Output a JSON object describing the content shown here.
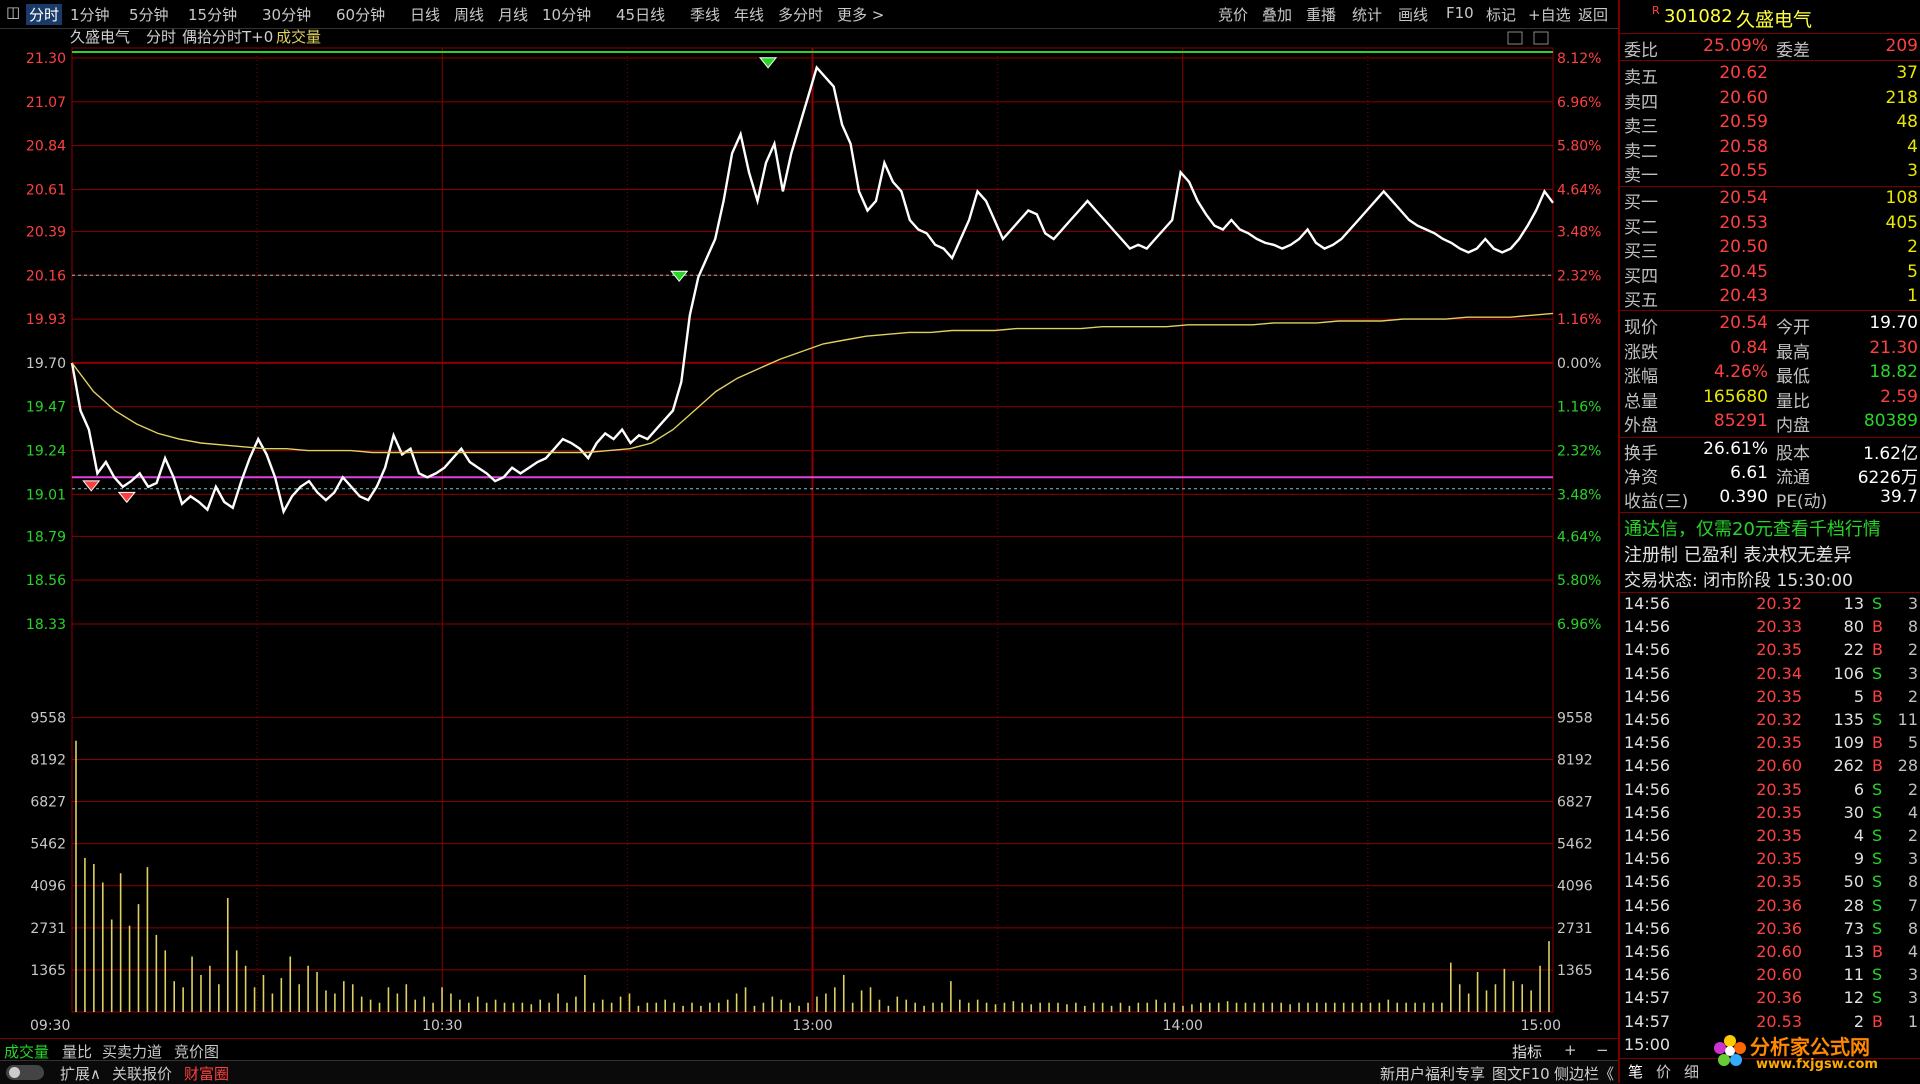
{
  "toolbar": {
    "periods": [
      "分时",
      "1分钟",
      "5分钟",
      "15分钟",
      "30分钟",
      "60分钟",
      "日线",
      "周线",
      "月线",
      "10分钟",
      "45日线",
      "季线",
      "年线",
      "多分时",
      "更多 >"
    ],
    "tools": [
      "竞价",
      "叠加",
      "重播",
      "统计",
      "画线",
      "F10",
      "标记",
      "+自选",
      "返回"
    ]
  },
  "chart_header": {
    "stock_name": "久盛电气",
    "mode": "分时",
    "indicator": "偶拾分时T+0",
    "volume_label": "成交量"
  },
  "colors": {
    "price_line": "#ffffff",
    "avg_line": "#e0d060",
    "grid": "#8b0000",
    "up": "#ff4040",
    "down": "#28d428",
    "high_line": "#28d428",
    "support_line": "#e040e0",
    "volume": "#e0d060"
  },
  "chart_data": [
    {
      "type": "line",
      "title": "分时",
      "x_ticks": [
        "09:30",
        "10:30",
        "13:00",
        "14:00",
        "15:00"
      ],
      "y_ticks_left": [
        "21.30",
        "21.07",
        "20.84",
        "20.61",
        "20.39",
        "20.16",
        "19.93",
        "19.70",
        "19.47",
        "19.24",
        "19.01",
        "18.79",
        "18.56",
        "18.33"
      ],
      "y_ticks_right": [
        "8.12%",
        "6.96%",
        "5.80%",
        "4.64%",
        "3.48%",
        "2.32%",
        "1.16%",
        "0.00%",
        "1.16%",
        "2.32%",
        "3.48%",
        "4.64%",
        "5.80%",
        "6.96%"
      ],
      "prev_close": 19.7,
      "ylim": [
        18.33,
        21.3
      ],
      "reference_lines": {
        "high": 21.3,
        "support": 19.1
      },
      "series": [
        {
          "name": "price",
          "values": [
            19.7,
            19.45,
            19.35,
            19.12,
            19.18,
            19.1,
            19.05,
            19.08,
            19.12,
            19.05,
            19.07,
            19.2,
            19.1,
            18.96,
            19.0,
            18.97,
            18.93,
            19.05,
            18.97,
            18.94,
            19.08,
            19.2,
            19.3,
            19.22,
            19.1,
            18.92,
            19.0,
            19.05,
            19.08,
            19.02,
            18.98,
            19.02,
            19.1,
            19.05,
            19.0,
            18.98,
            19.05,
            19.15,
            19.32,
            19.22,
            19.25,
            19.12,
            19.1,
            19.12,
            19.15,
            19.2,
            19.25,
            19.18,
            19.15,
            19.12,
            19.08,
            19.1,
            19.15,
            19.12,
            19.15,
            19.18,
            19.2,
            19.25,
            19.3,
            19.28,
            19.25,
            19.2,
            19.28,
            19.33,
            19.3,
            19.35,
            19.28,
            19.32,
            19.3,
            19.35,
            19.4,
            19.45,
            19.6,
            19.95,
            20.15,
            20.25,
            20.35,
            20.55,
            20.8,
            20.9,
            20.7,
            20.55,
            20.75,
            20.85,
            20.6,
            20.8,
            20.95,
            21.1,
            21.25,
            21.2,
            21.15,
            20.95,
            20.85,
            20.6,
            20.5,
            20.55,
            20.75,
            20.65,
            20.6,
            20.45,
            20.4,
            20.38,
            20.32,
            20.3,
            20.25,
            20.35,
            20.45,
            20.6,
            20.55,
            20.45,
            20.35,
            20.4,
            20.45,
            20.5,
            20.48,
            20.38,
            20.35,
            20.4,
            20.45,
            20.5,
            20.55,
            20.5,
            20.45,
            20.4,
            20.35,
            20.3,
            20.32,
            20.3,
            20.35,
            20.4,
            20.45,
            20.7,
            20.65,
            20.55,
            20.48,
            20.42,
            20.4,
            20.45,
            20.4,
            20.38,
            20.35,
            20.33,
            20.32,
            20.3,
            20.32,
            20.35,
            20.4,
            20.33,
            20.3,
            20.32,
            20.35,
            20.4,
            20.45,
            20.5,
            20.55,
            20.6,
            20.55,
            20.5,
            20.45,
            20.42,
            20.4,
            20.38,
            20.35,
            20.33,
            20.3,
            20.28,
            20.3,
            20.35,
            20.3,
            20.28,
            20.3,
            20.35,
            20.42,
            20.5,
            20.6,
            20.54
          ]
        },
        {
          "name": "avg",
          "values": [
            19.7,
            19.55,
            19.45,
            19.38,
            19.33,
            19.3,
            19.28,
            19.27,
            19.26,
            19.25,
            19.25,
            19.24,
            19.24,
            19.24,
            19.23,
            19.23,
            19.23,
            19.23,
            19.23,
            19.23,
            19.23,
            19.23,
            19.23,
            19.23,
            19.23,
            19.24,
            19.25,
            19.28,
            19.35,
            19.45,
            19.55,
            19.62,
            19.67,
            19.72,
            19.76,
            19.8,
            19.82,
            19.84,
            19.85,
            19.86,
            19.86,
            19.87,
            19.87,
            19.87,
            19.88,
            19.88,
            19.88,
            19.88,
            19.89,
            19.89,
            19.89,
            19.89,
            19.9,
            19.9,
            19.9,
            19.9,
            19.91,
            19.91,
            19.91,
            19.92,
            19.92,
            19.92,
            19.93,
            19.93,
            19.93,
            19.94,
            19.94,
            19.94,
            19.95,
            19.96
          ]
        }
      ]
    },
    {
      "type": "bar",
      "title": "成交量",
      "y_ticks": [
        "9558",
        "8192",
        "6827",
        "5462",
        "4096",
        "2731",
        "1365"
      ],
      "ylim": [
        0,
        10900
      ],
      "values": [
        8800,
        5000,
        4800,
        4200,
        3000,
        4500,
        2800,
        3500,
        4700,
        2500,
        2000,
        1000,
        800,
        1800,
        1200,
        1500,
        900,
        3700,
        2000,
        1500,
        800,
        1200,
        600,
        1100,
        1800,
        900,
        1500,
        1300,
        700,
        600,
        1000,
        900,
        500,
        400,
        300,
        800,
        600,
        900,
        400,
        500,
        300,
        800,
        600,
        400,
        300,
        500,
        300,
        400,
        300,
        300,
        300,
        250,
        400,
        300,
        600,
        300,
        500,
        1200,
        300,
        400,
        300,
        500,
        600,
        200,
        300,
        300,
        400,
        300,
        200,
        300,
        200,
        300,
        300,
        400,
        600,
        800,
        200,
        300,
        500,
        400,
        300,
        200,
        300,
        500,
        600,
        800,
        1200,
        300,
        700,
        800,
        400,
        200,
        500,
        400,
        300,
        200,
        300,
        300,
        1000,
        400,
        300,
        400,
        300,
        250,
        300,
        350,
        300,
        250,
        300,
        300,
        300,
        250,
        300,
        200,
        300,
        300,
        200,
        300,
        200,
        300,
        300,
        400,
        300,
        300,
        200,
        250,
        300,
        300,
        300,
        350,
        300,
        300,
        300,
        300,
        300,
        300,
        250,
        300,
        300,
        300,
        300,
        300,
        300,
        300,
        300,
        300,
        300,
        400,
        300,
        300,
        300,
        300,
        300,
        300,
        1600,
        900,
        600,
        1300,
        700,
        900,
        1400,
        1000,
        900,
        700,
        1500,
        2300
      ]
    }
  ],
  "quote": {
    "code_flag": "R",
    "code": "301082",
    "name": "久盛电气",
    "weibi_label": "委比",
    "weibi": "25.09%",
    "weicha_label": "委差",
    "weicha": "209",
    "asks": [
      {
        "label": "卖五",
        "price": "20.62",
        "vol": "37"
      },
      {
        "label": "卖四",
        "price": "20.60",
        "vol": "218"
      },
      {
        "label": "卖三",
        "price": "20.59",
        "vol": "48"
      },
      {
        "label": "卖二",
        "price": "20.58",
        "vol": "4"
      },
      {
        "label": "卖一",
        "price": "20.55",
        "vol": "3"
      }
    ],
    "bids": [
      {
        "label": "买一",
        "price": "20.54",
        "vol": "108"
      },
      {
        "label": "买二",
        "price": "20.53",
        "vol": "405"
      },
      {
        "label": "买三",
        "price": "20.50",
        "vol": "2"
      },
      {
        "label": "买四",
        "price": "20.45",
        "vol": "5"
      },
      {
        "label": "买五",
        "price": "20.43",
        "vol": "1"
      }
    ],
    "stats": [
      {
        "l1": "现价",
        "v1": "20.54",
        "l2": "今开",
        "v2": "19.70",
        "c1": "red",
        "c2": "white"
      },
      {
        "l1": "涨跌",
        "v1": "0.84",
        "l2": "最高",
        "v2": "21.30",
        "c1": "red",
        "c2": "red"
      },
      {
        "l1": "涨幅",
        "v1": "4.26%",
        "l2": "最低",
        "v2": "18.82",
        "c1": "red",
        "c2": "green"
      },
      {
        "l1": "总量",
        "v1": "165680",
        "l2": "量比",
        "v2": "2.59",
        "c1": "yellow",
        "c2": "red"
      },
      {
        "l1": "外盘",
        "v1": "85291",
        "l2": "内盘",
        "v2": "80389",
        "c1": "red",
        "c2": "green"
      }
    ],
    "fund": [
      {
        "l1": "换手",
        "v1": "26.61%",
        "l2": "股本",
        "v2": "1.62亿"
      },
      {
        "l1": "净资",
        "v1": "6.61",
        "l2": "流通",
        "v2": "6226万"
      },
      {
        "l1": "收益(三)",
        "v1": "0.390",
        "l2": "PE(动)",
        "v2": "39.7"
      }
    ],
    "promo": "通达信，仅需20元查看千档行情",
    "reg": "注册制 已盈利 表决权无差异",
    "status": "交易状态: 闭市阶段 15:30:00"
  },
  "ticks": [
    {
      "t": "14:56",
      "p": "20.32",
      "v": "13",
      "d": "S",
      "n": "3"
    },
    {
      "t": "14:56",
      "p": "20.33",
      "v": "80",
      "d": "B",
      "n": "8"
    },
    {
      "t": "14:56",
      "p": "20.35",
      "v": "22",
      "d": "B",
      "n": "2"
    },
    {
      "t": "14:56",
      "p": "20.34",
      "v": "106",
      "d": "S",
      "n": "3"
    },
    {
      "t": "14:56",
      "p": "20.35",
      "v": "5",
      "d": "B",
      "n": "2"
    },
    {
      "t": "14:56",
      "p": "20.32",
      "v": "135",
      "d": "S",
      "n": "11"
    },
    {
      "t": "14:56",
      "p": "20.35",
      "v": "109",
      "d": "B",
      "n": "5"
    },
    {
      "t": "14:56",
      "p": "20.60",
      "v": "262",
      "d": "B",
      "n": "28"
    },
    {
      "t": "14:56",
      "p": "20.35",
      "v": "6",
      "d": "S",
      "n": "2"
    },
    {
      "t": "14:56",
      "p": "20.35",
      "v": "30",
      "d": "S",
      "n": "4"
    },
    {
      "t": "14:56",
      "p": "20.35",
      "v": "4",
      "d": "S",
      "n": "2"
    },
    {
      "t": "14:56",
      "p": "20.35",
      "v": "9",
      "d": "S",
      "n": "3"
    },
    {
      "t": "14:56",
      "p": "20.35",
      "v": "50",
      "d": "S",
      "n": "8"
    },
    {
      "t": "14:56",
      "p": "20.36",
      "v": "28",
      "d": "S",
      "n": "7"
    },
    {
      "t": "14:56",
      "p": "20.36",
      "v": "73",
      "d": "S",
      "n": "8"
    },
    {
      "t": "14:56",
      "p": "20.60",
      "v": "13",
      "d": "B",
      "n": "4"
    },
    {
      "t": "14:56",
      "p": "20.60",
      "v": "11",
      "d": "S",
      "n": "3"
    },
    {
      "t": "14:57",
      "p": "20.36",
      "v": "12",
      "d": "S",
      "n": "3"
    },
    {
      "t": "14:57",
      "p": "20.53",
      "v": "2",
      "d": "B",
      "n": "1"
    },
    {
      "t": "15:00",
      "p": "",
      "v": "",
      "d": "",
      "n": ""
    }
  ],
  "bottom": {
    "tabs1": [
      "成交量",
      "量比",
      "买卖力道",
      "竞价图"
    ],
    "indicator_btn": "指标",
    "plus": "+",
    "minus": "−",
    "tabs2": [
      "扩展∧",
      "关联报价",
      "财富圈"
    ],
    "right_items": [
      "新用户福利专享",
      "图文F10",
      "侧边栏《"
    ],
    "panel_tabs": [
      "笔",
      "价",
      "细"
    ],
    "logo_text": "分析家公式网",
    "logo_url": "www.fxjgsw.com"
  }
}
